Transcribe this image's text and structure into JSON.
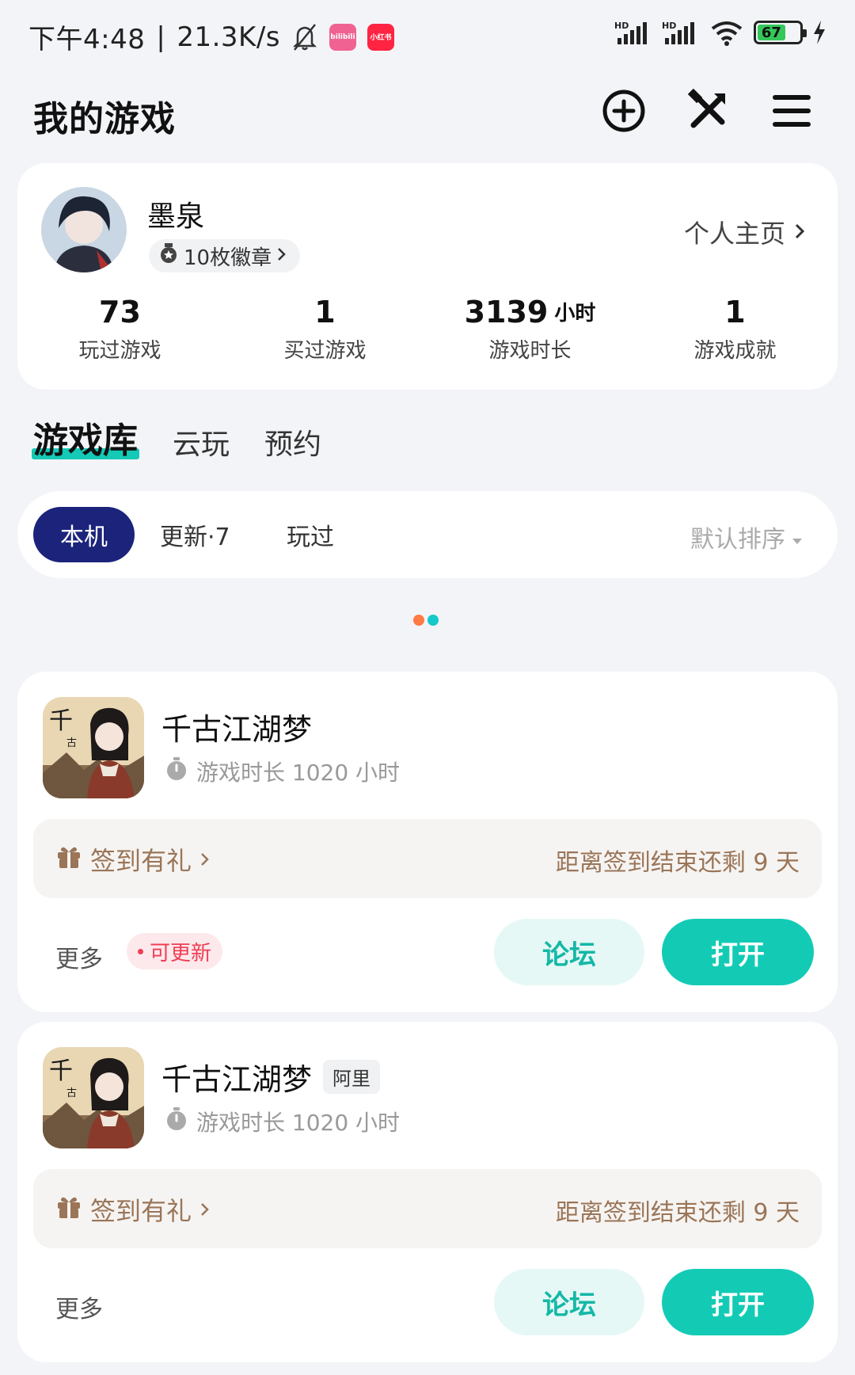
{
  "status_bar": {
    "time": "下午4:48",
    "separator": "|",
    "network_speed": "21.3K/s",
    "icons": [
      "bell-off-icon",
      "bilibili-app-icon",
      "xiaohongshu-app-icon",
      "hd-signal-icon",
      "hd-signal-icon",
      "wifi-icon",
      "battery-icon",
      "charging-icon"
    ],
    "bilibili_label": "bilibili",
    "xhs_label": "小红书",
    "signal_label": "HD",
    "battery": "67"
  },
  "header": {
    "title": "我的游戏",
    "icons": [
      "add-circle-icon",
      "tools-icon",
      "menu-icon"
    ]
  },
  "profile": {
    "name": "墨泉",
    "badges": "10枚徽章",
    "home_link": "个人主页",
    "stats": [
      {
        "value": "73",
        "unit": "",
        "label": "玩过游戏"
      },
      {
        "value": "1",
        "unit": "",
        "label": "买过游戏"
      },
      {
        "value": "3139",
        "unit": "小时",
        "label": "游戏时长"
      },
      {
        "value": "1",
        "unit": "",
        "label": "游戏成就"
      }
    ]
  },
  "tabs": [
    "游戏库",
    "云玩",
    "预约"
  ],
  "filters": {
    "chips": [
      "本机",
      "更新·7",
      "玩过"
    ],
    "sort": "默认排序"
  },
  "colors": {
    "accent": "#13cbb5",
    "navy": "#1b237a",
    "checkin_text": "#9a7558",
    "update_red": "#ee3e55",
    "dot_orange": "#ff7a45",
    "dot_teal": "#14c9c9"
  },
  "games": [
    {
      "name": "千古江湖梦",
      "tag": "",
      "play_time": "游戏时长 1020 小时",
      "checkin": "签到有礼",
      "checkin_remaining": "距离签到结束还剩 9 天",
      "more": "更多",
      "update": "可更新",
      "forum": "论坛",
      "open": "打开"
    },
    {
      "name": "千古江湖梦",
      "tag": "阿里",
      "play_time": "游戏时长 1020 小时",
      "checkin": "签到有礼",
      "checkin_remaining": "距离签到结束还剩 9 天",
      "more": "更多",
      "update": "",
      "forum": "论坛",
      "open": "打开"
    }
  ]
}
